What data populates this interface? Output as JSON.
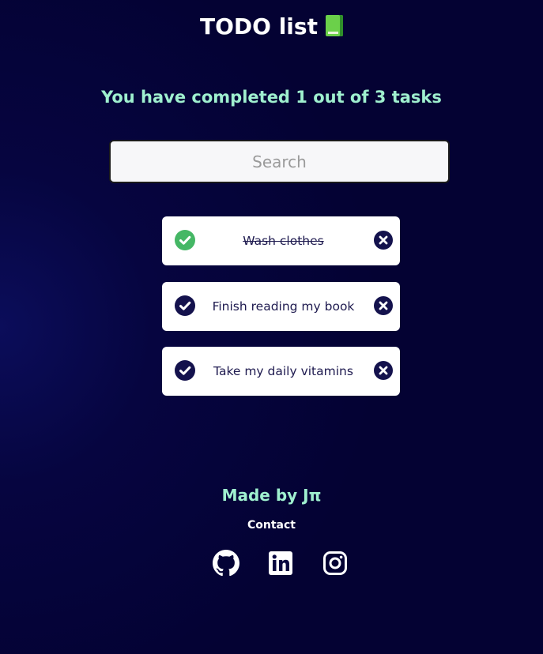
{
  "header": {
    "title": "TODO list",
    "icon": "green-book-icon"
  },
  "summary": {
    "text": "You have completed 1 out of 3 tasks",
    "completed": 1,
    "total": 3
  },
  "search": {
    "placeholder": "Search",
    "value": ""
  },
  "tasks": [
    {
      "text": "Wash clothes",
      "completed": true
    },
    {
      "text": "Finish reading my book",
      "completed": false
    },
    {
      "text": "Take my daily vitamins",
      "completed": false
    }
  ],
  "footer": {
    "made_by": "Made by Jπ",
    "contact_label": "Contact",
    "social": [
      "github-icon",
      "linkedin-icon",
      "instagram-icon"
    ]
  },
  "colors": {
    "background": "#040233",
    "accent": "#9ff0cf",
    "task_text": "#1e1a4f",
    "icon_dark": "#14124d",
    "done_green": "#45b765"
  }
}
